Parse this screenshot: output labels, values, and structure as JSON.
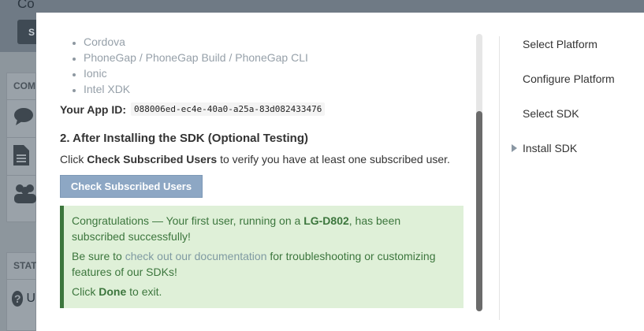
{
  "background": {
    "title": "Co",
    "button_label": "S",
    "section1_header": "COM",
    "section2_header": "STAT",
    "help_label": "U"
  },
  "modal": {
    "sdk_list": [
      "Cordova",
      "PhoneGap / PhoneGap Build / PhoneGap CLI",
      "Ionic",
      "Intel XDK"
    ],
    "app_id_label": "Your App ID:",
    "app_id_value": "088006ed-ec4e-40a0-a25a-83d082433476",
    "step_title": "2. After Installing the SDK (Optional Testing)",
    "step_desc_pre": "Click ",
    "step_desc_bold": "Check Subscribed Users",
    "step_desc_post": " to verify you have at least one subscribed user.",
    "check_button": "Check Subscribed Users",
    "alert": {
      "line1_pre": "Congratulations — Your first user, running on a ",
      "line1_device": "LG-D802",
      "line1_post": ", has been subscribed successfully!",
      "line2_pre": "Be sure to ",
      "line2_link": "check out our documentation",
      "line2_post": " for troubleshooting or customizing features of our SDKs!",
      "line3_pre": "Click ",
      "line3_bold": "Done",
      "line3_post": " to exit."
    }
  },
  "steps_nav": [
    {
      "label": "Select Platform"
    },
    {
      "label": "Configure Platform"
    },
    {
      "label": "Select SDK"
    },
    {
      "label": "Install SDK"
    }
  ],
  "colors": {
    "alert_bg": "#dff0d8",
    "alert_text": "#3c763d",
    "button_bg": "#8da7c4",
    "overlay": "#8d969d"
  }
}
